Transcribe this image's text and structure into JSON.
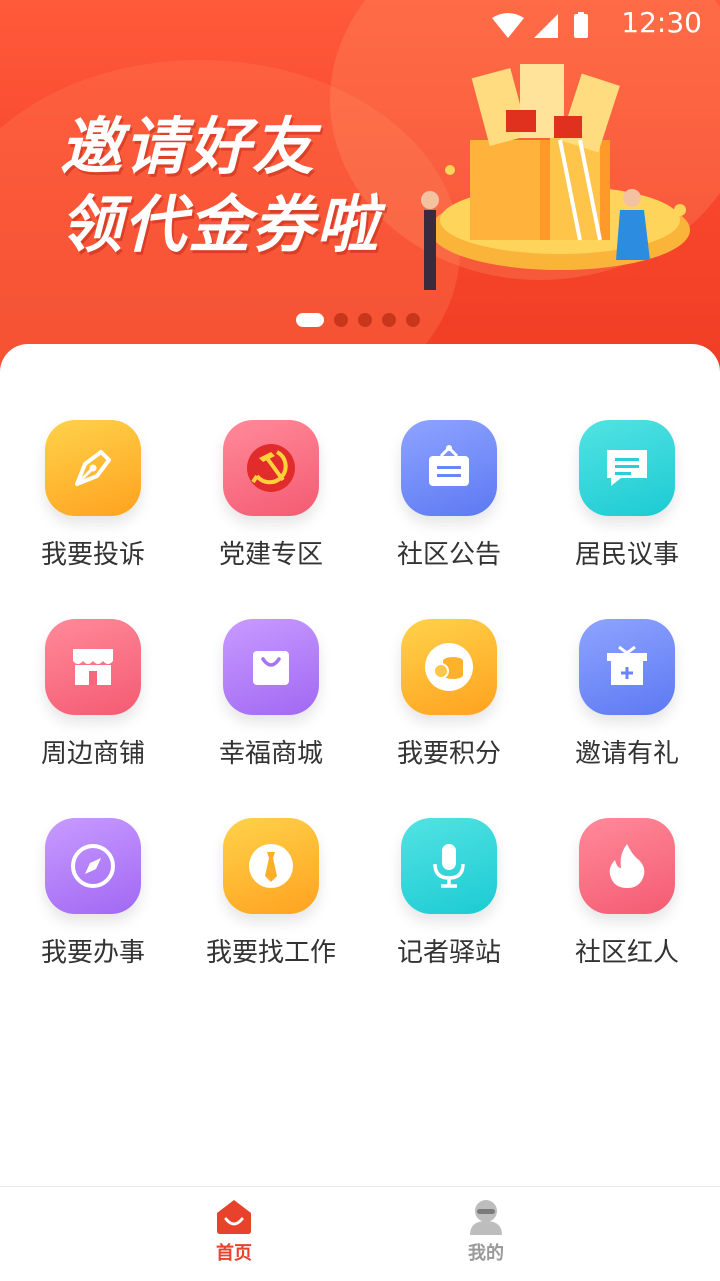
{
  "status_bar": {
    "time": "12:30"
  },
  "banner": {
    "headline_line1": "邀请好友",
    "headline_line2": "领代金券啦",
    "dots": [
      true,
      false,
      false,
      false,
      false
    ]
  },
  "grid": {
    "items": [
      {
        "label": "我要投诉",
        "icon": "pen-nib-icon",
        "color_top": "#ffd24a",
        "color_bottom": "#ffa21f"
      },
      {
        "label": "党建专区",
        "icon": "hammer-sickle-icon",
        "color_top": "#ff8a9a",
        "color_bottom": "#f45b72"
      },
      {
        "label": "社区公告",
        "icon": "notice-board-icon",
        "color_top": "#8fa4ff",
        "color_bottom": "#5c79f2"
      },
      {
        "label": "居民议事",
        "icon": "chat-bubble-icon",
        "color_top": "#52e3e3",
        "color_bottom": "#1ccbd3"
      },
      {
        "label": "周边商铺",
        "icon": "storefront-icon",
        "color_top": "#ff8a9a",
        "color_bottom": "#f45b72"
      },
      {
        "label": "幸福商城",
        "icon": "shopping-bag-icon",
        "color_top": "#c89bff",
        "color_bottom": "#a168f3"
      },
      {
        "label": "我要积分",
        "icon": "coins-icon",
        "color_top": "#ffd24a",
        "color_bottom": "#ffa21f"
      },
      {
        "label": "邀请有礼",
        "icon": "gift-box-icon",
        "color_top": "#8fa4ff",
        "color_bottom": "#5c79f2"
      },
      {
        "label": "我要办事",
        "icon": "compass-icon",
        "color_top": "#c89bff",
        "color_bottom": "#a168f3"
      },
      {
        "label": "我要找工作",
        "icon": "necktie-icon",
        "color_top": "#ffd24a",
        "color_bottom": "#ffa21f"
      },
      {
        "label": "记者驿站",
        "icon": "microphone-icon",
        "color_top": "#52e3e3",
        "color_bottom": "#1ccbd3"
      },
      {
        "label": "社区红人",
        "icon": "flame-icon",
        "color_top": "#ff8a9a",
        "color_bottom": "#f45b72"
      }
    ]
  },
  "tabbar": {
    "home_label": "首页",
    "mine_label": "我的",
    "active_color": "#e8422c",
    "inactive_color": "#999999"
  }
}
